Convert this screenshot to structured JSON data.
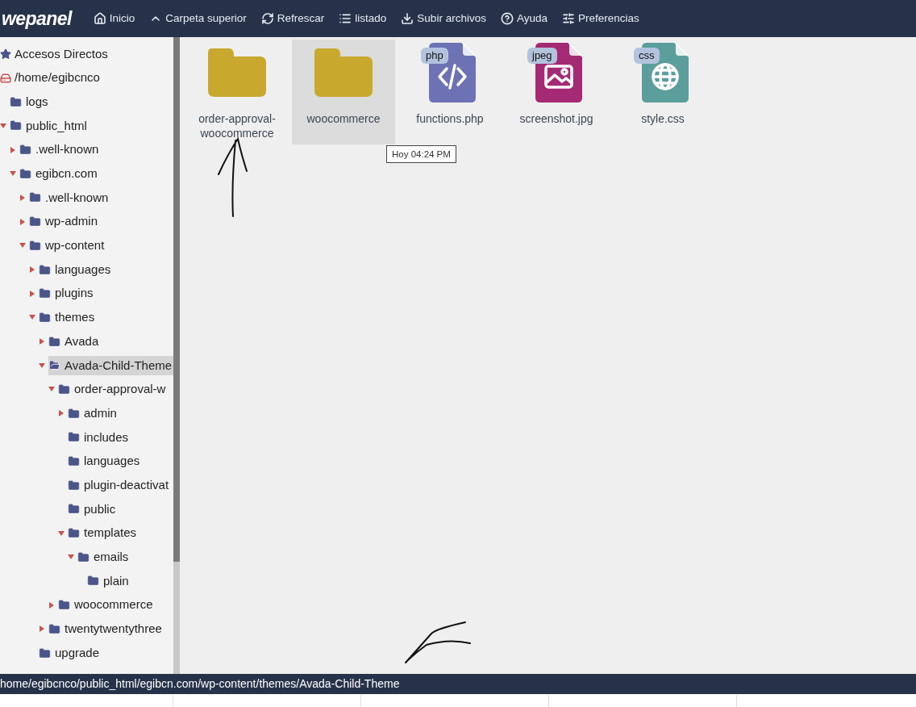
{
  "header": {
    "logo": "wepanel",
    "menu": [
      {
        "kind": "home",
        "label": "Inicio"
      },
      {
        "kind": "up",
        "label": "Carpeta superior"
      },
      {
        "kind": "refresh",
        "label": "Refrescar"
      },
      {
        "kind": "list",
        "label": "listado"
      },
      {
        "kind": "upload",
        "label": "Subir archivos"
      },
      {
        "kind": "help",
        "label": "Ayuda"
      },
      {
        "kind": "prefs",
        "label": "Preferencias"
      }
    ]
  },
  "sidebar": {
    "shortcuts": "Accesos Directos",
    "root": "/home/egibcnco",
    "tree": [
      {
        "name": "logs",
        "kind": "plain",
        "selected": false
      },
      {
        "name": "public_html",
        "kind": "collapsible",
        "expanded": true,
        "selected": false,
        "children": [
          {
            "name": ".well-known",
            "kind": "collapsible",
            "expanded": false,
            "selected": false
          },
          {
            "name": "egibcn.com",
            "kind": "collapsible",
            "expanded": true,
            "selected": false,
            "children": [
              {
                "name": ".well-known",
                "kind": "collapsible",
                "expanded": false,
                "selected": false
              },
              {
                "name": "wp-admin",
                "kind": "collapsible",
                "expanded": false,
                "selected": false
              },
              {
                "name": "wp-content",
                "kind": "collapsible",
                "expanded": true,
                "selected": false,
                "children": [
                  {
                    "name": "languages",
                    "kind": "collapsible",
                    "expanded": false,
                    "selected": false
                  },
                  {
                    "name": "plugins",
                    "kind": "collapsible",
                    "expanded": false,
                    "selected": false
                  },
                  {
                    "name": "themes",
                    "kind": "collapsible",
                    "expanded": true,
                    "selected": false,
                    "children": [
                      {
                        "name": "Avada",
                        "kind": "collapsible",
                        "expanded": false,
                        "selected": false
                      },
                      {
                        "name": "Avada-Child-Theme",
                        "kind": "collapsible",
                        "expanded": true,
                        "selected": true,
                        "children": [
                          {
                            "name": "order-approval-w",
                            "kind": "collapsible",
                            "expanded": true,
                            "selected": false,
                            "children": [
                              {
                                "name": "admin",
                                "kind": "collapsible",
                                "expanded": false,
                                "selected": false
                              },
                              {
                                "name": "includes",
                                "kind": "plain",
                                "selected": false
                              },
                              {
                                "name": "languages",
                                "kind": "plain",
                                "selected": false
                              },
                              {
                                "name": "plugin-deactivat",
                                "kind": "plain",
                                "selected": false
                              },
                              {
                                "name": "public",
                                "kind": "plain",
                                "selected": false
                              },
                              {
                                "name": "templates",
                                "kind": "collapsible",
                                "expanded": true,
                                "selected": false,
                                "children": [
                                  {
                                    "name": "emails",
                                    "kind": "collapsible",
                                    "expanded": true,
                                    "selected": false,
                                    "children": [
                                      {
                                        "name": "plain",
                                        "kind": "plain",
                                        "selected": false
                                      }
                                    ]
                                  }
                                ]
                              }
                            ]
                          },
                          {
                            "name": "woocommerce",
                            "kind": "collapsible",
                            "expanded": false,
                            "selected": false
                          }
                        ]
                      },
                      {
                        "name": "twentytwentythree",
                        "kind": "collapsible",
                        "expanded": false,
                        "selected": false
                      }
                    ]
                  },
                  {
                    "name": "upgrade",
                    "kind": "plain",
                    "selected": false
                  }
                ]
              }
            ]
          }
        ]
      }
    ]
  },
  "files": [
    {
      "kind": "folder",
      "name": "order-approval-woocommerce",
      "selected": false
    },
    {
      "kind": "folder",
      "name": "woocommerce",
      "selected": true
    },
    {
      "kind": "code",
      "name": "functions.php",
      "badge": "php",
      "color": "#6d72b5"
    },
    {
      "kind": "image",
      "name": "screenshot.jpg",
      "badge": "jpeg",
      "color": "#a52a74"
    },
    {
      "kind": "web",
      "name": "style.css",
      "badge": "css",
      "color": "#5c9e9c"
    }
  ],
  "tooltip": "Hoy 04:24 PM",
  "status_bar": {
    "path": "home/egibcnco/public_html/egibcn.com/wp-content/themes/Avada-Child-Theme"
  }
}
